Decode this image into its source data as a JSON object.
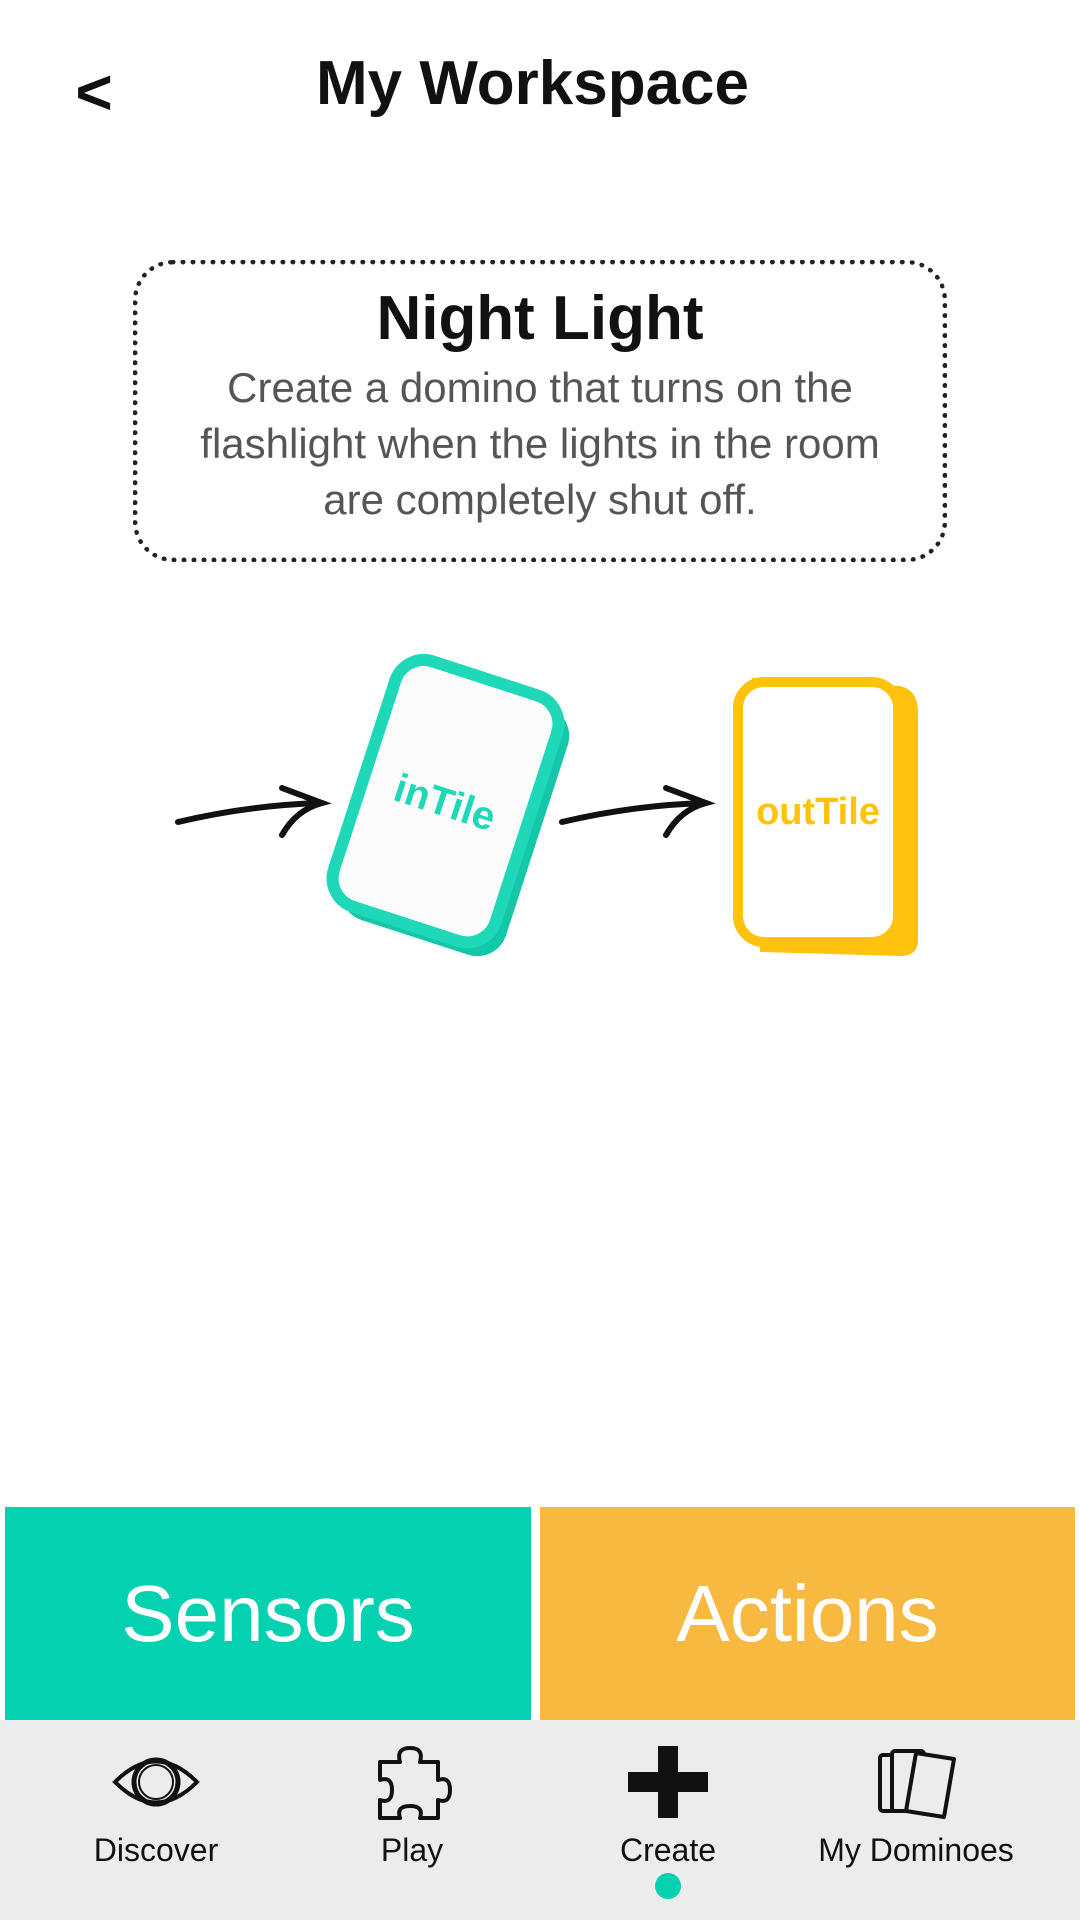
{
  "header": {
    "back_label": "<",
    "title": "My Workspace"
  },
  "task": {
    "title": "Night Light",
    "description": "Create a domino that turns on the flashlight when the lights in the room are completely shut off."
  },
  "flow": {
    "in_tile_label": "inTile",
    "out_tile_label": "outTile",
    "in_tile_color": "#1ed8b8",
    "out_tile_color": "#ffc20e"
  },
  "tabs": {
    "sensors_label": "Sensors",
    "actions_label": "Actions",
    "sensors_color": "#03d1b0",
    "actions_color": "#f7b940"
  },
  "nav": {
    "items": [
      {
        "label": "Discover",
        "icon": "eye-icon"
      },
      {
        "label": "Play",
        "icon": "puzzle-icon"
      },
      {
        "label": "Create",
        "icon": "plus-icon",
        "active": true
      },
      {
        "label": "My Dominoes",
        "icon": "cards-icon"
      }
    ],
    "active_color": "#03d1b0"
  }
}
